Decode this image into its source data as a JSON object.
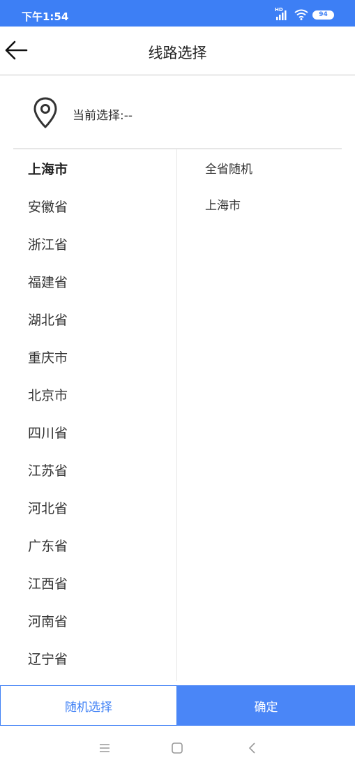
{
  "status_bar": {
    "time": "下午1:54",
    "battery": "94",
    "hd_label": "HD",
    "icons": [
      "signal-icon",
      "wifi-icon",
      "battery-icon"
    ]
  },
  "header": {
    "title": "线路选择",
    "back_icon": "arrow-left-icon"
  },
  "current": {
    "icon": "location-pin-icon",
    "label": "当前选择:--"
  },
  "provinces": [
    {
      "label": "上海市",
      "selected": true
    },
    {
      "label": "安徽省",
      "selected": false
    },
    {
      "label": "浙江省",
      "selected": false
    },
    {
      "label": "福建省",
      "selected": false
    },
    {
      "label": "湖北省",
      "selected": false
    },
    {
      "label": "重庆市",
      "selected": false
    },
    {
      "label": "北京市",
      "selected": false
    },
    {
      "label": "四川省",
      "selected": false
    },
    {
      "label": "江苏省",
      "selected": false
    },
    {
      "label": "河北省",
      "selected": false
    },
    {
      "label": "广东省",
      "selected": false
    },
    {
      "label": "江西省",
      "selected": false
    },
    {
      "label": "河南省",
      "selected": false
    },
    {
      "label": "辽宁省",
      "selected": false
    }
  ],
  "cities": [
    {
      "label": "全省随机"
    },
    {
      "label": "上海市"
    }
  ],
  "actions": {
    "random_label": "随机选择",
    "confirm_label": "确定"
  },
  "colors": {
    "accent": "#3d7ff5",
    "confirm_bg": "#4a86f7"
  },
  "system_nav": [
    "menu-icon",
    "home-icon",
    "back-icon"
  ]
}
